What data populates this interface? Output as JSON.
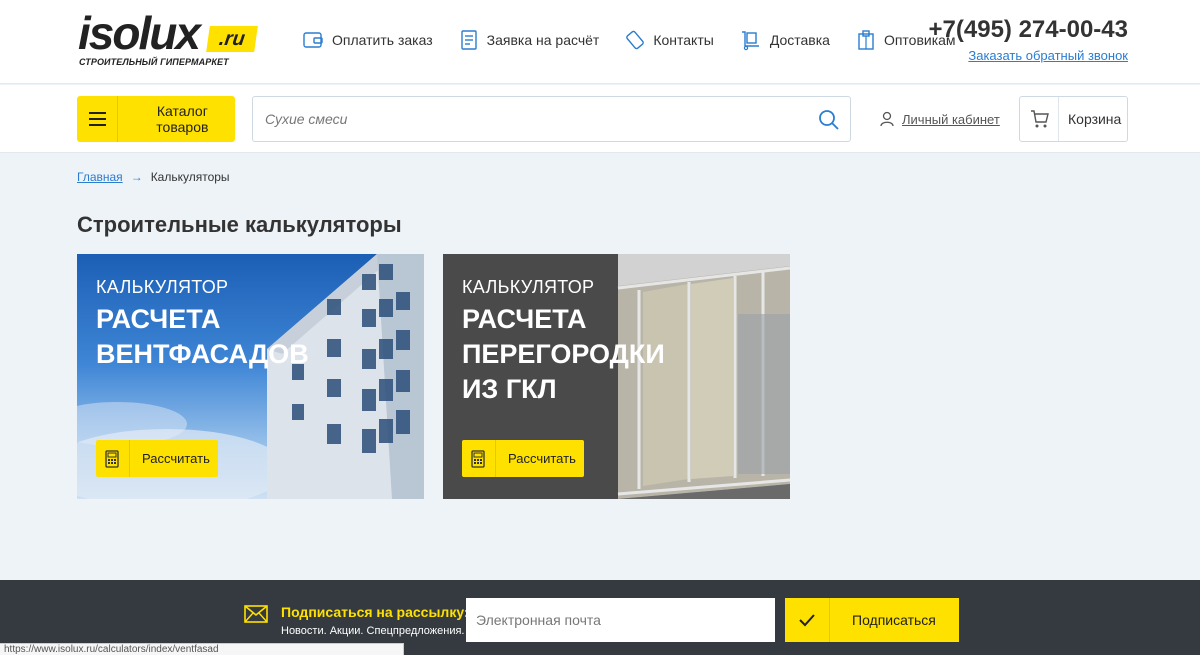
{
  "header": {
    "logo_text": "isolux",
    "logo_domain": ".ru",
    "logo_tagline": "СТРОИТЕЛЬНЫЙ ГИПЕРМАРКЕТ",
    "nav": [
      {
        "label": "Оплатить заказ",
        "icon": "wallet-icon"
      },
      {
        "label": "Заявка на расчёт",
        "icon": "document-icon"
      },
      {
        "label": "Контакты",
        "icon": "phone-icon"
      },
      {
        "label": "Доставка",
        "icon": "truck-icon"
      },
      {
        "label": "Оптовикам",
        "icon": "boxes-icon"
      }
    ],
    "phone": "+7(495) 274-00-43",
    "callback_label": "Заказать обратный звонок"
  },
  "searchbar": {
    "catalog_label": "Каталог товаров",
    "search_placeholder": "Сухие смеси",
    "account_label": "Личный кабинет",
    "cart_label": "Корзина"
  },
  "breadcrumb": {
    "home": "Главная",
    "arrow": "→",
    "current": "Калькуляторы"
  },
  "page_title": "Строительные калькуляторы",
  "cards": [
    {
      "eyebrow": "КАЛЬКУЛЯТОР",
      "headline": "РАСЧЕТА\nВЕНТФАСАДОВ",
      "button_label": "Рассчитать"
    },
    {
      "eyebrow": "КАЛЬКУЛЯТОР",
      "headline": "РАСЧЕТА\nПЕРЕГОРОДКИ\nИЗ ГКЛ",
      "button_label": "Рассчитать"
    }
  ],
  "footer": {
    "subscribe_title": "Подписаться на рассылку:",
    "subscribe_text": "Новости. Акции. Спецпредложения.",
    "email_placeholder": "Электронная почта",
    "subscribe_button": "Подписаться"
  },
  "status_url": "https://www.isolux.ru/calculators/index/ventfasad",
  "colors": {
    "accent": "#ffe100",
    "link": "#2a7dd1",
    "footer_bg": "#343a40",
    "page_bg": "#eef3f8"
  }
}
